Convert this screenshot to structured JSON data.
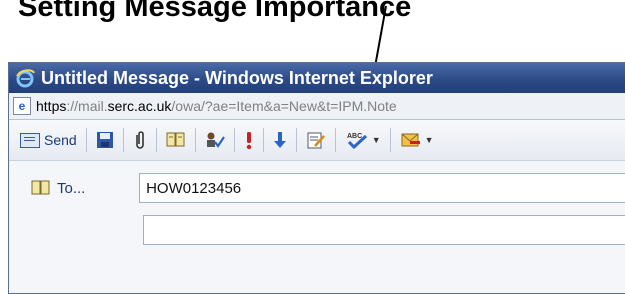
{
  "annotation": {
    "text": "Setting Message Importance"
  },
  "window": {
    "title": "Untitled Message - Windows Internet Explorer"
  },
  "address": {
    "scheme": "https",
    "sep": "://mail.",
    "domain": "serc.ac.uk",
    "path": "/owa/?ae=Item&a=New&t=IPM.Note"
  },
  "toolbar": {
    "send_label": "Send"
  },
  "form": {
    "to_label": "To...",
    "to_value": "HOW0123456"
  },
  "colors": {
    "titlebar": "#2c4a86",
    "importance_high": "#cc1f1f",
    "importance_low": "#2a64c8"
  }
}
